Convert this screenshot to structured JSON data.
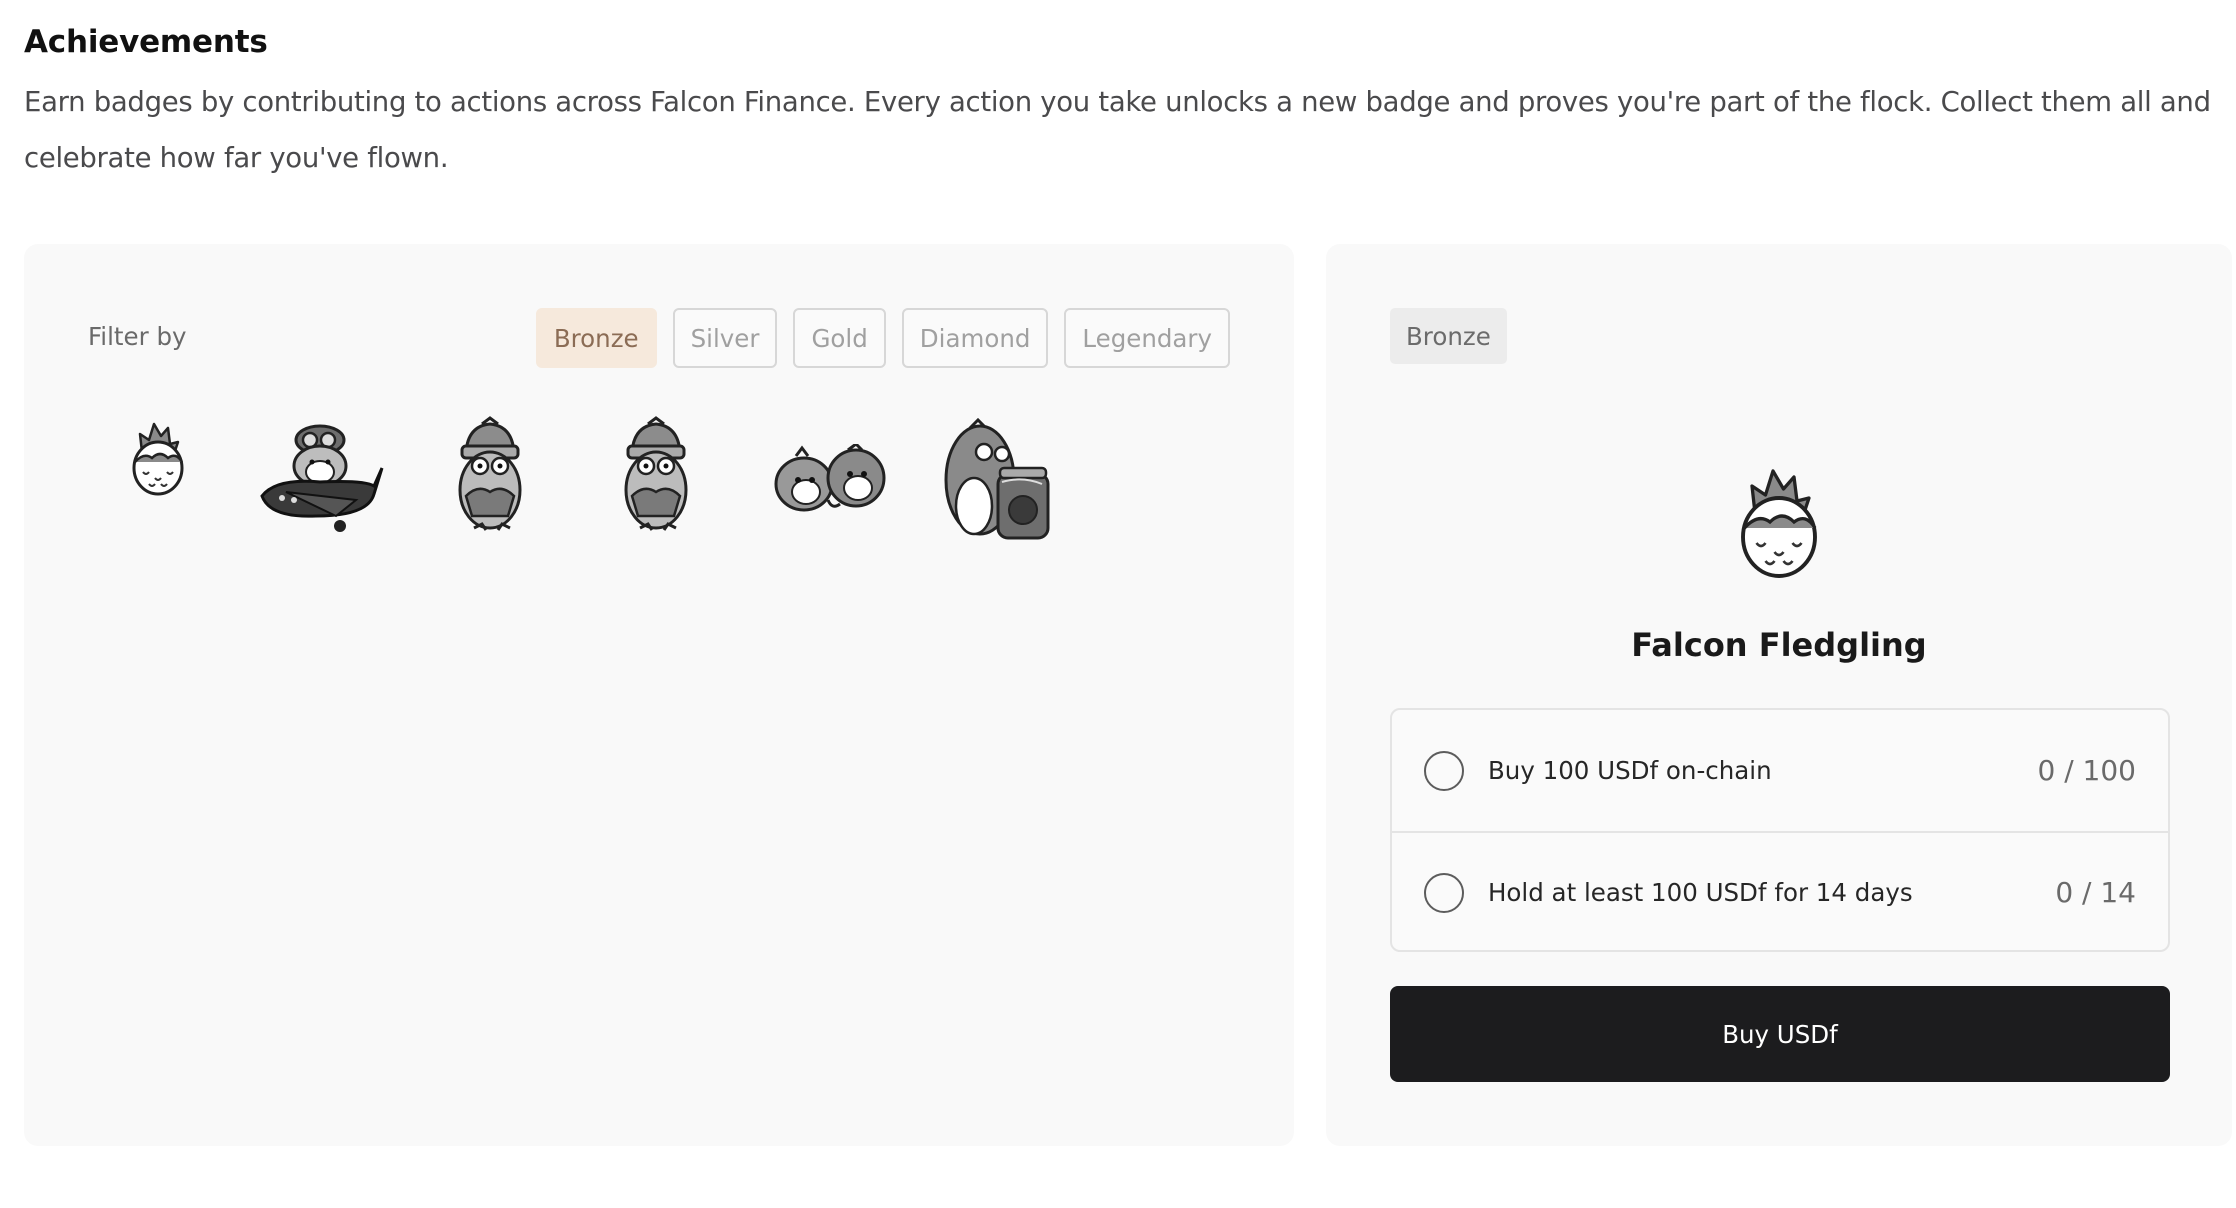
{
  "header": {
    "title": "Achievements",
    "description": "Earn badges by contributing to actions across Falcon Finance. Every action you take unlocks a new badge and proves you're part of the flock. Collect them all and celebrate how far you've flown."
  },
  "filter": {
    "label": "Filter by",
    "options": [
      "Bronze",
      "Silver",
      "Gold",
      "Diamond",
      "Legendary"
    ],
    "selected": "Bronze"
  },
  "badges": [
    {
      "icon": "hatching-egg-icon"
    },
    {
      "icon": "bird-pilot-airplane-icon"
    },
    {
      "icon": "bird-with-beanie-icon"
    },
    {
      "icon": "bird-with-beanie-icon"
    },
    {
      "icon": "two-birds-icon"
    },
    {
      "icon": "bird-with-jar-icon"
    }
  ],
  "detail": {
    "tier": "Bronze",
    "badge_icon": "hatching-egg-icon",
    "name": "Falcon Fledgling",
    "tasks": [
      {
        "label": "Buy 100 USDf on-chain",
        "progress": "0 / 100"
      },
      {
        "label": "Hold at least 100 USDf for 14 days",
        "progress": "0 / 14"
      }
    ],
    "button_label": "Buy USDf"
  },
  "colors": {
    "accent_chip_bg": "#f6e9dc",
    "accent_chip_text": "#8b6c55",
    "primary_button": "#1c1c1e",
    "panel_bg": "#f9f9f9"
  }
}
